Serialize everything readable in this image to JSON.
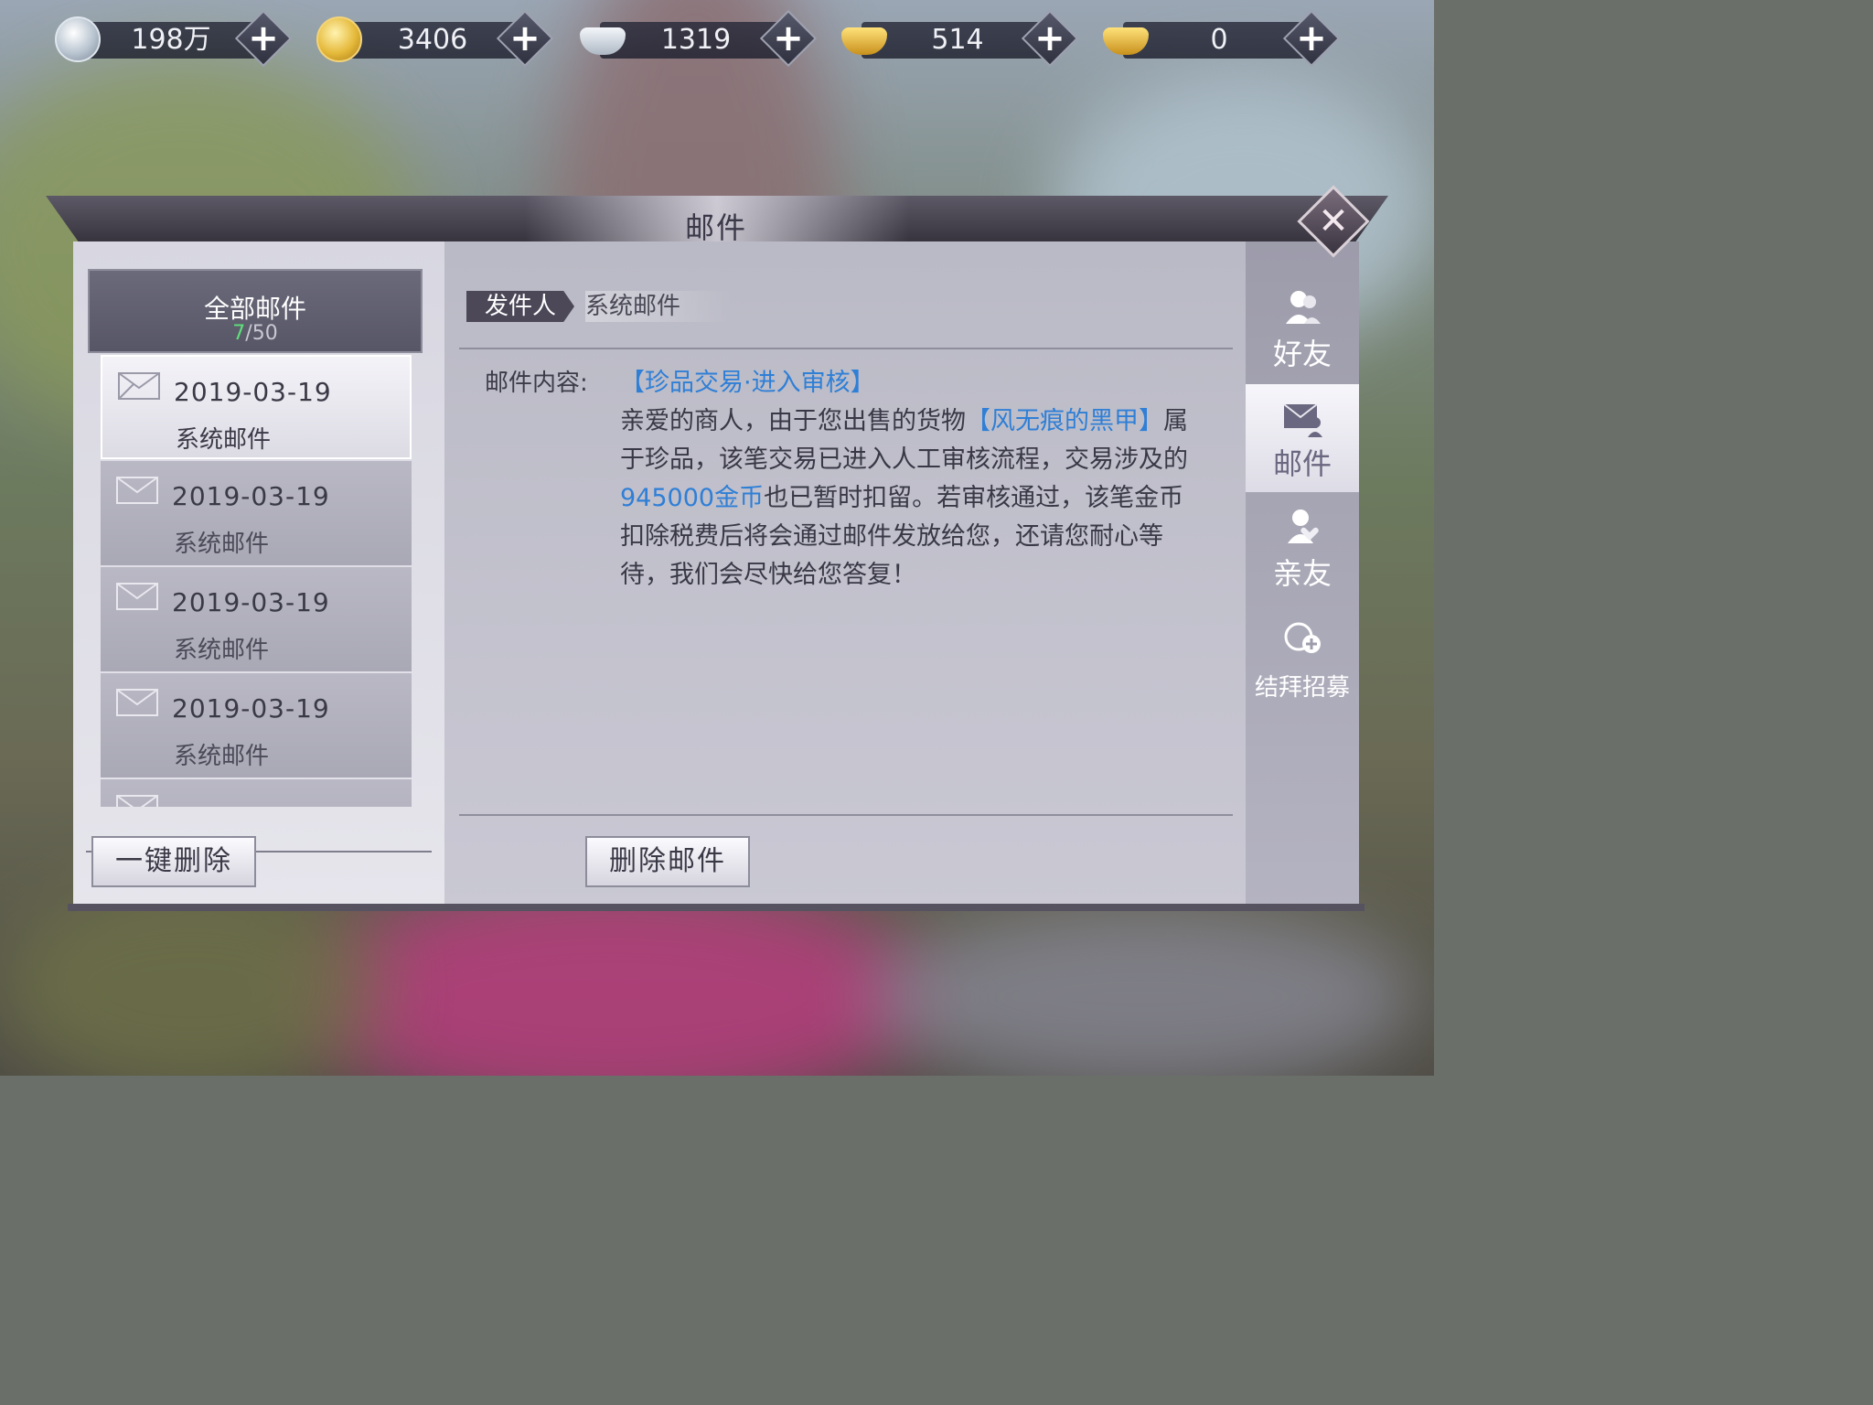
{
  "currencies": [
    {
      "id": "silver-coin",
      "icon": "silver-coin-icon",
      "value": "198万"
    },
    {
      "id": "gold-coin",
      "icon": "gold-coin-icon",
      "value": "3406"
    },
    {
      "id": "silver-ingot",
      "icon": "silver-ingot-icon",
      "value": "1319"
    },
    {
      "id": "locked-gold-ingot",
      "icon": "locked-gold-ingot-icon",
      "value": "514"
    },
    {
      "id": "gold-ingot",
      "icon": "gold-ingot-icon",
      "value": "0"
    }
  ],
  "dialog": {
    "title": "邮件",
    "close_icon": "close-icon"
  },
  "left": {
    "all_mail_label": "全部邮件",
    "count_current": "7",
    "count_total": "/50",
    "mails": [
      {
        "date": "2019-03-19",
        "from": "系统邮件",
        "selected": true
      },
      {
        "date": "2019-03-19",
        "from": "系统邮件",
        "selected": false
      },
      {
        "date": "2019-03-19",
        "from": "系统邮件",
        "selected": false
      },
      {
        "date": "2019-03-19",
        "from": "系统邮件",
        "selected": false
      }
    ],
    "delete_all_label": "一键删除"
  },
  "main": {
    "sender_label": "发件人",
    "sender_value": "系统邮件",
    "content_label": "邮件内容:",
    "subject": "【珍品交易·进入审核】",
    "body_1": "亲爱的商人，由于您出售的货物",
    "item_name": "【风无痕的黑甲】",
    "body_2": "属于珍品，该笔交易已进入人工审核流程，交易涉及的",
    "amount": "945000金币",
    "body_3": "也已暂时扣留。若审核通过，该笔金币扣除税费后将会通过邮件发放给您，还请您耐心等待，我们会尽快给您答复！",
    "delete_label": "删除邮件"
  },
  "nav": [
    {
      "label": "好友",
      "icon": "friends-icon",
      "active": false
    },
    {
      "label": "邮件",
      "icon": "mail-icon",
      "active": true
    },
    {
      "label": "亲友",
      "icon": "relatives-icon",
      "active": false
    },
    {
      "label": "结拜招募",
      "icon": "sworn-recruit-icon",
      "active": false
    }
  ]
}
